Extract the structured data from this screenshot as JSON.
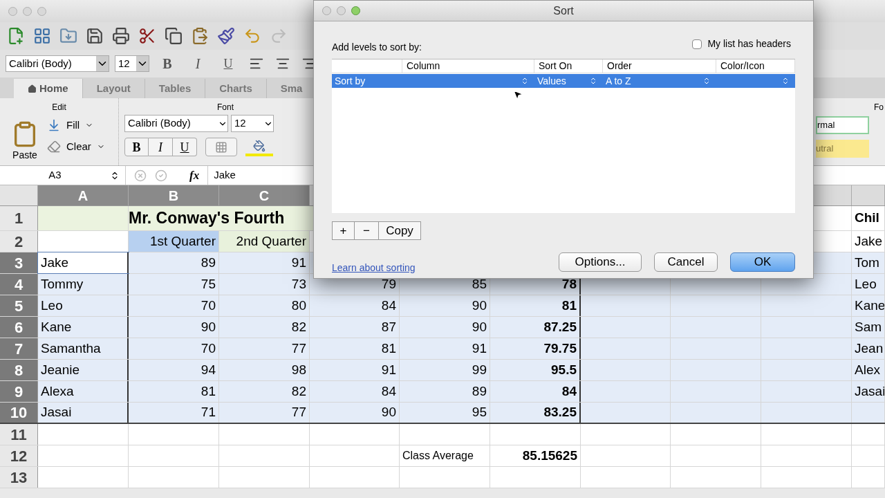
{
  "format_bar": {
    "font": "Calibri (Body)",
    "size": "12",
    "bold": "B",
    "italic": "I",
    "underline": "U"
  },
  "ribbon_tabs": [
    {
      "label": "Home",
      "selected": true
    },
    {
      "label": "Layout",
      "selected": false
    },
    {
      "label": "Tables",
      "selected": false
    },
    {
      "label": "Charts",
      "selected": false
    },
    {
      "label": "Sma",
      "selected": false
    }
  ],
  "ribbon": {
    "edit_label": "Edit",
    "font_label": "Font",
    "paste": "Paste",
    "fill": "Fill",
    "clear": "Clear",
    "font": "Calibri (Body)",
    "size": "12",
    "bold": "B",
    "italic": "I",
    "underline": "U",
    "format_label": "Fo",
    "styles": [
      {
        "label": "rmal",
        "color": "#ffffff"
      },
      {
        "label": "utral",
        "color": "#fbe98f"
      }
    ]
  },
  "formula_bar": {
    "name_box": "A3",
    "fx": "fx",
    "value": "Jake"
  },
  "sheet": {
    "columns": [
      {
        "label": "A",
        "selected": true
      },
      {
        "label": "B",
        "selected": true
      },
      {
        "label": "C",
        "selected": true
      }
    ],
    "rows": [
      {
        "number": "1",
        "selected": false,
        "color": "#ebf3df",
        "cells": [
          {},
          {
            "text": "Mr. Conway's Fourth",
            "kind": "title"
          },
          {},
          {},
          {},
          {},
          {},
          {},
          {},
          {
            "text": "Chil",
            "kind": "heading"
          }
        ]
      },
      {
        "number": "2",
        "selected": false,
        "cells": [
          {},
          {
            "text": "1st Quarter",
            "kind": "heading",
            "color": "#b7d0f0"
          },
          {
            "text": "2nd Quarter",
            "kind": "heading",
            "color": "#e8f1dc"
          },
          {},
          {},
          {},
          {},
          {},
          {},
          {
            "text": "Jake",
            "kind": "text"
          }
        ]
      },
      {
        "number": "3",
        "selected": true,
        "cells": [
          {
            "text": "Jake",
            "kind": "text",
            "active": true
          },
          {
            "text": "89",
            "kind": "number"
          },
          {
            "text": "91",
            "kind": "number"
          },
          {},
          {},
          {},
          {},
          {},
          {},
          {
            "text": "Tom",
            "kind": "text"
          }
        ]
      },
      {
        "number": "4",
        "selected": true,
        "cells": [
          {
            "text": "Tommy",
            "kind": "text"
          },
          {
            "text": "75",
            "kind": "number"
          },
          {
            "text": "73",
            "kind": "number"
          },
          {
            "text": "79",
            "kind": "number"
          },
          {
            "text": "85",
            "kind": "number"
          },
          {
            "text": "78",
            "kind": "total"
          },
          {},
          {},
          {},
          {
            "text": "Leo",
            "kind": "text"
          }
        ]
      },
      {
        "number": "5",
        "selected": true,
        "cells": [
          {
            "text": "Leo",
            "kind": "text"
          },
          {
            "text": "70",
            "kind": "number"
          },
          {
            "text": "80",
            "kind": "number"
          },
          {
            "text": "84",
            "kind": "number"
          },
          {
            "text": "90",
            "kind": "number"
          },
          {
            "text": "81",
            "kind": "total"
          },
          {},
          {},
          {},
          {
            "text": "Kane",
            "kind": "text"
          }
        ]
      },
      {
        "number": "6",
        "selected": true,
        "cells": [
          {
            "text": "Kane",
            "kind": "text"
          },
          {
            "text": "90",
            "kind": "number"
          },
          {
            "text": "82",
            "kind": "number"
          },
          {
            "text": "87",
            "kind": "number"
          },
          {
            "text": "90",
            "kind": "number"
          },
          {
            "text": "87.25",
            "kind": "total"
          },
          {},
          {},
          {},
          {
            "text": "Sam",
            "kind": "text"
          }
        ]
      },
      {
        "number": "7",
        "selected": true,
        "cells": [
          {
            "text": "Samantha",
            "kind": "text"
          },
          {
            "text": "70",
            "kind": "number"
          },
          {
            "text": "77",
            "kind": "number"
          },
          {
            "text": "81",
            "kind": "number"
          },
          {
            "text": "91",
            "kind": "number"
          },
          {
            "text": "79.75",
            "kind": "total"
          },
          {},
          {},
          {},
          {
            "text": "Jean",
            "kind": "text"
          }
        ]
      },
      {
        "number": "8",
        "selected": true,
        "cells": [
          {
            "text": "Jeanie",
            "kind": "text"
          },
          {
            "text": "94",
            "kind": "number"
          },
          {
            "text": "98",
            "kind": "number"
          },
          {
            "text": "91",
            "kind": "number"
          },
          {
            "text": "99",
            "kind": "number"
          },
          {
            "text": "95.5",
            "kind": "total"
          },
          {},
          {},
          {},
          {
            "text": "Alex",
            "kind": "text"
          }
        ]
      },
      {
        "number": "9",
        "selected": true,
        "cells": [
          {
            "text": "Alexa",
            "kind": "text"
          },
          {
            "text": "81",
            "kind": "number"
          },
          {
            "text": "82",
            "kind": "number"
          },
          {
            "text": "84",
            "kind": "number"
          },
          {
            "text": "89",
            "kind": "number"
          },
          {
            "text": "84",
            "kind": "total"
          },
          {},
          {},
          {},
          {
            "text": "Jasai",
            "kind": "text"
          }
        ]
      },
      {
        "number": "10",
        "selected": true,
        "cells": [
          {
            "text": "Jasai",
            "kind": "text"
          },
          {
            "text": "71",
            "kind": "number"
          },
          {
            "text": "77",
            "kind": "number"
          },
          {
            "text": "90",
            "kind": "number"
          },
          {
            "text": "95",
            "kind": "number"
          },
          {
            "text": "83.25",
            "kind": "total"
          },
          {},
          {},
          {},
          {}
        ]
      },
      {
        "number": "11",
        "selected": false,
        "cells": []
      },
      {
        "number": "12",
        "selected": false,
        "cells": [
          {},
          {},
          {},
          {},
          {
            "text": "Class Average",
            "kind": "label"
          },
          {
            "text": "85.15625",
            "kind": "total"
          },
          {},
          {},
          {},
          {}
        ]
      },
      {
        "number": "13",
        "selected": false,
        "cells": []
      }
    ]
  },
  "dialog": {
    "title": "Sort",
    "prompt": "Add levels to sort by:",
    "headers_checkbox": {
      "label": "My list has headers",
      "checked": false
    },
    "columns": [
      "Column",
      "Sort On",
      "Order",
      "Color/Icon"
    ],
    "levels": [
      {
        "label": "Sort by",
        "sort_on": "Values",
        "order": "A to Z",
        "selected": true
      }
    ],
    "add": "+",
    "remove": "−",
    "copy": "Copy",
    "link": "Learn about sorting",
    "buttons": [
      {
        "label": "Options...",
        "default": false
      },
      {
        "label": "Cancel",
        "default": false
      },
      {
        "label": "OK",
        "default": true
      }
    ]
  }
}
